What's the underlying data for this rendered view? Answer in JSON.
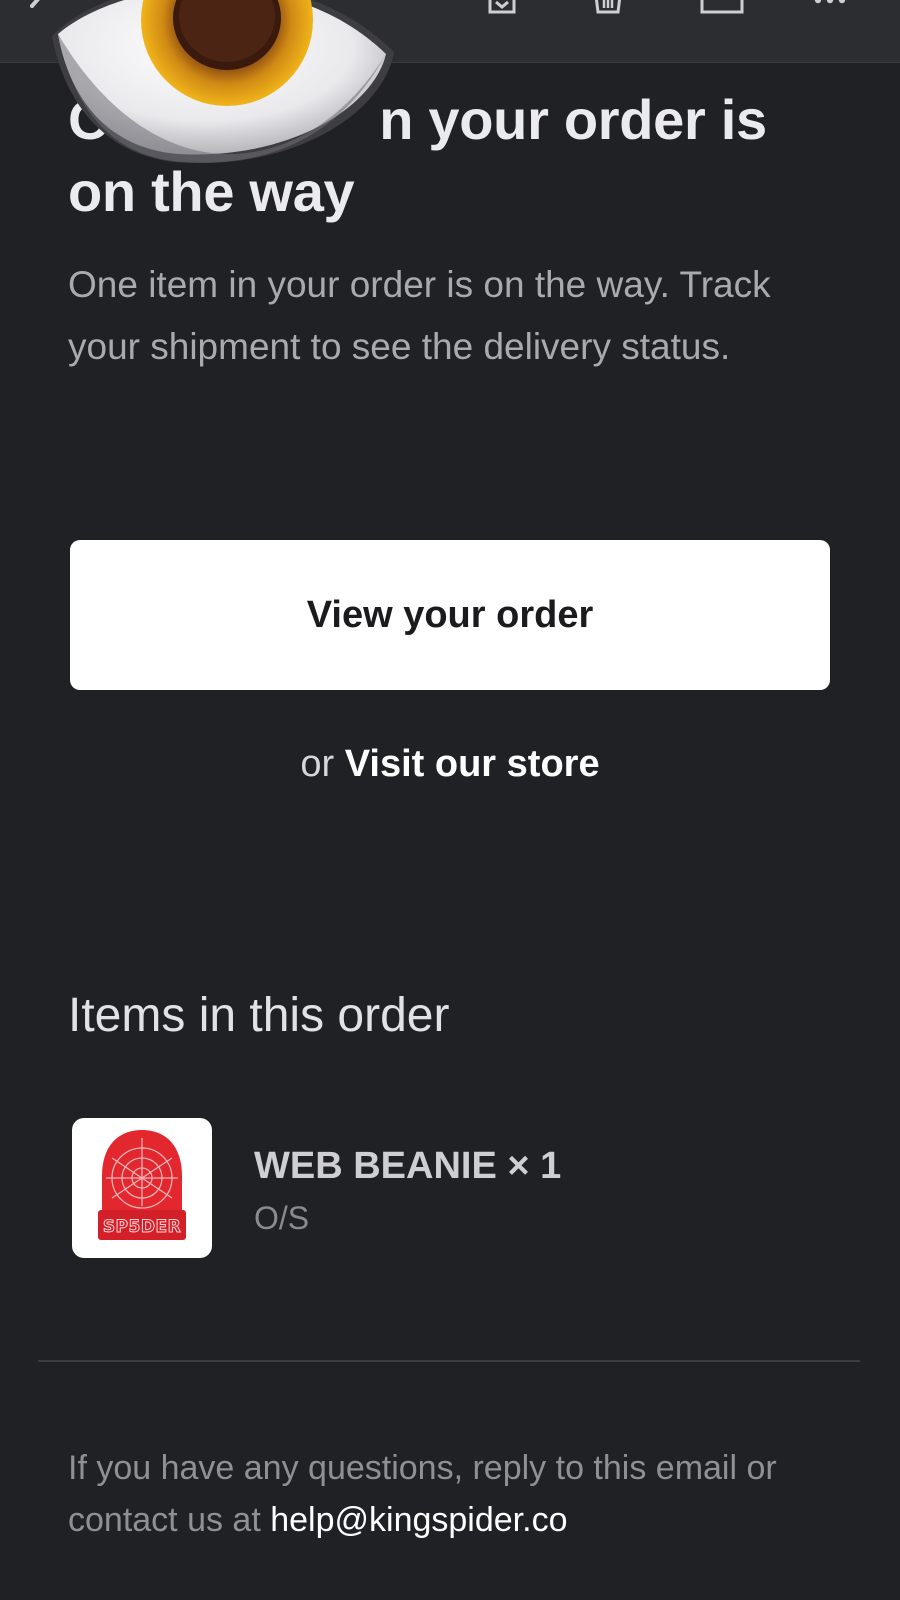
{
  "email": {
    "headline_visible": "O        n your order is on the way",
    "headline_line1_start": "O",
    "headline_line1_end": "n your order is",
    "headline_line2": "on the way",
    "intro": "One item in your order is on the way. Track your shipment to see the delivery status.",
    "primary_button_label": "View your order",
    "visit_prefix": "or ",
    "visit_link_label": "Visit our store",
    "items_heading": "Items in this order",
    "items": [
      {
        "name": "WEB BEANIE × 1",
        "variant": "O/S",
        "thumbnail_brand_text": "SP5DER",
        "thumbnail_color": "#e2272f"
      }
    ],
    "footer_text": "If you have any questions, reply to this email or contact us at ",
    "footer_email": "help@kingspider.co"
  },
  "toolbar": {
    "icons": [
      "back-chevron-icon",
      "archive-icon",
      "trash-icon",
      "mail-icon",
      "more-icon"
    ]
  },
  "overlay": {
    "emoji": "eye-emoji"
  },
  "colors": {
    "background": "#202124",
    "toolbar": "#2c2d31",
    "button_bg": "#ffffff",
    "button_text": "#1b1b1d",
    "muted_text": "#a9aaae",
    "beanie_red": "#e2272f"
  }
}
